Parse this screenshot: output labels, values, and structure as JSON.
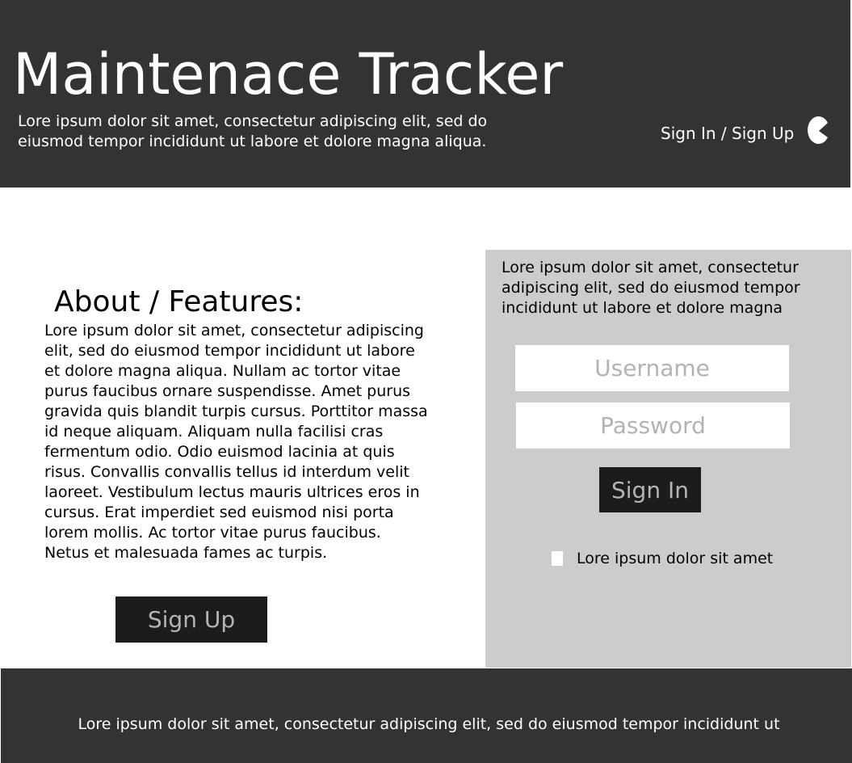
{
  "header": {
    "title": "Maintenace Tracker",
    "description": "Lore ipsum dolor sit amet, consectetur adipiscing elit, sed do eiusmod tempor incididunt ut labore et dolore magna aliqua.",
    "auth_link": "Sign In / Sign Up",
    "user_icon": "user-icon"
  },
  "about": {
    "heading": "About / Features:",
    "text": "Lore ipsum dolor sit amet, consectetur adipiscing elit, sed do eiusmod tempor incididunt ut labore et dolore magna aliqua. Nullam ac tortor vitae purus faucibus ornare suspendisse. Amet purus gravida quis blandit turpis cursus. Porttitor massa id neque aliquam. Aliquam nulla facilisi cras fermentum odio. Odio euismod lacinia at quis risus. Convallis convallis tellus id interdum velit laoreet. Vestibulum lectus mauris ultrices eros in cursus. Erat imperdiet sed euismod nisi porta lorem mollis. Ac tortor vitae purus faucibus. Netus et malesuada fames ac turpis.",
    "signup_label": "Sign Up"
  },
  "login": {
    "description": "Lore ipsum dolor sit amet, consectetur adipiscing elit, sed do eiusmod tempor incididunt ut labore et dolore magna",
    "username_placeholder": "Username",
    "password_placeholder": "Password",
    "signin_label": "Sign In",
    "remember_label": "Lore ipsum dolor sit amet"
  },
  "footer": {
    "text": "Lore ipsum dolor sit amet, consectetur adipiscing elit, sed do eiusmod tempor incididunt ut"
  },
  "colors": {
    "header_bg": "#333333",
    "panel_bg": "#cccccc",
    "button_bg": "#1c1c1c",
    "button_text": "#b4b4b4"
  }
}
